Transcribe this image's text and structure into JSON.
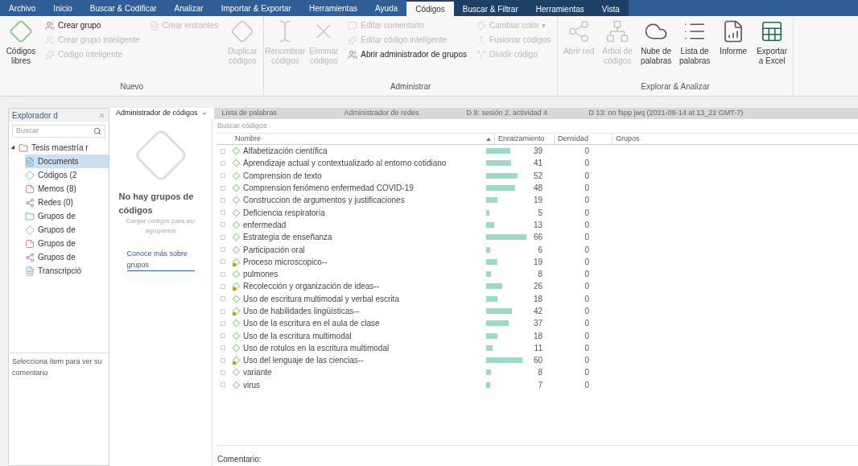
{
  "menu_tabs": [
    {
      "label": "Archivo",
      "selected": false,
      "context": false
    },
    {
      "label": "Inicio",
      "selected": false,
      "context": false
    },
    {
      "label": "Buscar & Codificar",
      "selected": false,
      "context": false
    },
    {
      "label": "Analizar",
      "selected": false,
      "context": false
    },
    {
      "label": "Importar & Exportar",
      "selected": false,
      "context": false
    },
    {
      "label": "Herramientas",
      "selected": false,
      "context": false
    },
    {
      "label": "Ayuda",
      "selected": false,
      "context": false
    },
    {
      "label": "Códigos",
      "selected": true,
      "context": true
    },
    {
      "label": "Buscar & Filtrar",
      "selected": false,
      "context": true
    },
    {
      "label": "Herramientas",
      "selected": false,
      "context": true
    },
    {
      "label": "Vista",
      "selected": false,
      "context": true
    }
  ],
  "ribbon": [
    {
      "title": "Nuevo",
      "items": [
        {
          "kind": "large",
          "label": "Códigos libres",
          "disabled": false
        },
        {
          "kind": "stack",
          "items": [
            {
              "label": "Crear grupo",
              "disabled": false
            },
            {
              "label": "Crear grupo inteligente",
              "disabled": true
            },
            {
              "label": "Código inteligente",
              "disabled": true
            }
          ]
        },
        {
          "kind": "stack",
          "items": [
            {
              "label": "Crear entrantes",
              "disabled": true
            }
          ]
        },
        {
          "kind": "large",
          "label": "Duplicar códigos",
          "disabled": true
        }
      ]
    },
    {
      "title": "Administrar",
      "items": [
        {
          "kind": "large",
          "label": "Renombrar códigos",
          "disabled": true
        },
        {
          "kind": "large",
          "label": "Eliminar códigos",
          "disabled": true
        },
        {
          "kind": "stack",
          "items": [
            {
              "label": "Editar comentario",
              "disabled": true
            },
            {
              "label": "Editar código inteligente",
              "disabled": true
            },
            {
              "label": "Abrir administrador de grupos",
              "disabled": false
            }
          ]
        },
        {
          "kind": "stack",
          "items": [
            {
              "label": "Cambiar color ▾",
              "disabled": true
            },
            {
              "label": "Fusionar códigos",
              "disabled": true
            },
            {
              "label": "Dividir código",
              "disabled": true
            }
          ]
        }
      ]
    },
    {
      "title": "Explorar & Analizar",
      "items": [
        {
          "kind": "large",
          "label": "Abrir red",
          "disabled": true
        },
        {
          "kind": "large",
          "label": "Árbol de códigos",
          "disabled": true
        },
        {
          "kind": "large",
          "label": "Nube de palabras",
          "disabled": false
        },
        {
          "kind": "large",
          "label": "Lista de palabras",
          "disabled": false
        },
        {
          "kind": "large",
          "label": "Informe",
          "disabled": false
        },
        {
          "kind": "large",
          "label": "Exportar a Excel",
          "disabled": false
        }
      ]
    }
  ],
  "explorer": {
    "title": "Explorador d",
    "search": {
      "placeholder": "Buscar"
    },
    "tree": [
      {
        "label": "Tesis maestría r",
        "kind": "project",
        "expanded": true,
        "selected": false,
        "children": [
          {
            "label": "Documents",
            "kind": "document",
            "selected": true
          },
          {
            "label": "Códigos (2",
            "kind": "code",
            "selected": false
          },
          {
            "label": "Memos (8)",
            "kind": "memo",
            "selected": false
          },
          {
            "label": "Redes (0)",
            "kind": "network",
            "selected": false
          },
          {
            "label": "Grupos de",
            "kind": "folder",
            "selected": false
          },
          {
            "label": "Grupos de",
            "kind": "code",
            "selected": false
          },
          {
            "label": "Grupos de",
            "kind": "memo",
            "selected": false
          },
          {
            "label": "Grupos de",
            "kind": "network",
            "selected": false
          },
          {
            "label": "Transcripció",
            "kind": "document",
            "selected": false
          }
        ]
      }
    ],
    "comment_hint": "Selecciona ítem para ver su comentario"
  },
  "doc_tabs": [
    {
      "label": "Administrador de códigos",
      "selected": true
    },
    {
      "label": "Lista de palabras",
      "selected": false
    },
    {
      "label": "Administrador de redes",
      "selected": false
    },
    {
      "label": "D 9: sesión 2. actividad 4",
      "selected": false
    },
    {
      "label": "D 13: nn fspp jwq (2021-09-14 at 13_22 GMT-7)",
      "selected": false
    }
  ],
  "groups_panel": {
    "title": "No hay grupos de códigos",
    "text": "Cargar códigos para así agruparlos",
    "link": "Conoce más sobre grupos"
  },
  "code_manager": {
    "search": {
      "placeholder": "Buscar códigos"
    },
    "columns": [
      "Nombre",
      "Enraizamiento",
      "Densidad",
      "Grupos"
    ],
    "rows": [
      {
        "name": "Alfabetización científica",
        "kind": "code",
        "checked": false,
        "grounded": "39",
        "density": "0"
      },
      {
        "name": "Aprendizaje actual y contextualizado al entorno cotidiano",
        "kind": "code",
        "checked": false,
        "grounded": "41",
        "density": "0"
      },
      {
        "name": "Comprension de texto",
        "kind": "code",
        "checked": false,
        "grounded": "52",
        "density": "0"
      },
      {
        "name": "Comprension fenómeno enfermedad COVID-19",
        "kind": "code",
        "checked": false,
        "grounded": "48",
        "density": "0"
      },
      {
        "name": "Construccion de argumentos y justificaciones",
        "kind": "code",
        "checked": false,
        "grounded": "19",
        "density": "0"
      },
      {
        "name": "Deficiencia respiratoria",
        "kind": "code",
        "checked": false,
        "grounded": "5",
        "density": "0"
      },
      {
        "name": "enfermedad",
        "kind": "code",
        "checked": false,
        "grounded": "13",
        "density": "0"
      },
      {
        "name": "Estrategia de enseñanza",
        "kind": "code",
        "checked": false,
        "grounded": "66",
        "density": "0"
      },
      {
        "name": "Participación oral",
        "kind": "code",
        "checked": false,
        "grounded": "6",
        "density": "0"
      },
      {
        "name": "Proceso microscopico--",
        "kind": "parent",
        "checked": false,
        "grounded": "19",
        "density": "0"
      },
      {
        "name": "pulmones",
        "kind": "code",
        "checked": false,
        "grounded": "8",
        "density": "0"
      },
      {
        "name": "Recolección y organización de ideas--",
        "kind": "parent",
        "checked": false,
        "grounded": "26",
        "density": "0"
      },
      {
        "name": "Uso de escritura multimodal y verbal escrita",
        "kind": "code",
        "checked": false,
        "grounded": "18",
        "density": "0"
      },
      {
        "name": "Uso de habilidades lingüísticas--",
        "kind": "parent",
        "checked": false,
        "grounded": "42",
        "density": "0"
      },
      {
        "name": "Uso de la escritura en el aula de clase",
        "kind": "code",
        "checked": false,
        "grounded": "37",
        "density": "0"
      },
      {
        "name": "Uso de la escritura multimodal",
        "kind": "code",
        "checked": false,
        "grounded": "18",
        "density": "0"
      },
      {
        "name": "Uso de rotulos en la escritura multimodal",
        "kind": "code",
        "checked": false,
        "grounded": "11",
        "density": "0"
      },
      {
        "name": "Uso del lenguaje de las ciencias--",
        "kind": "parent",
        "checked": false,
        "grounded": "60",
        "density": "0"
      },
      {
        "name": "variante",
        "kind": "code",
        "checked": false,
        "grounded": "8",
        "density": "0"
      },
      {
        "name": "virus",
        "kind": "code",
        "checked": false,
        "grounded": "7",
        "density": "0"
      }
    ],
    "comment_label": "Comentario:"
  }
}
